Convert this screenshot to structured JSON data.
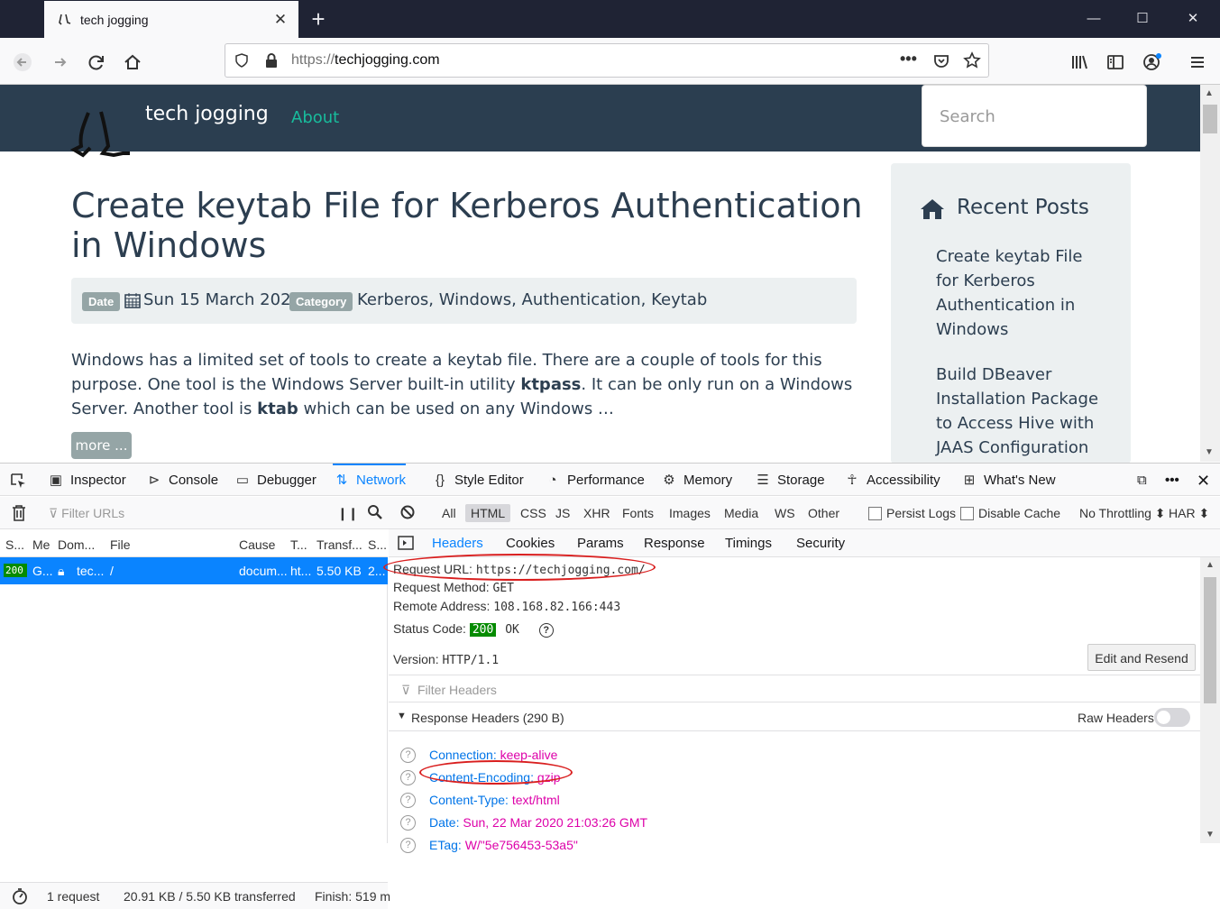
{
  "browser": {
    "tab_title": "tech jogging",
    "url_protocol": "https://",
    "url_host": "techjogging.com"
  },
  "site": {
    "name": "tech jogging",
    "nav_about": "About",
    "search_placeholder": "Search",
    "post_title": "Create keytab File for Kerberos Authentication in Windows",
    "date_badge": "Date",
    "date": "Sun 15 March 2020",
    "category_badge": "Category",
    "categories": "Kerberos, Windows, Authentication, Keytab",
    "excerpt_1": "Windows has a limited set of tools to create a keytab file. There are a couple of tools for this purpose. One tool is the Windows Server built-in utility ",
    "excerpt_bold_1": "ktpass",
    "excerpt_2": ". It can be only run on a Windows Server. Another tool is ",
    "excerpt_bold_2": "ktab",
    "excerpt_3": " which can be used on any Windows …",
    "more_button": "more ...",
    "sidebar_heading": "Recent Posts",
    "recent_posts": [
      "Create keytab File for Kerberos Authentication in Windows",
      "Build DBeaver Installation Package to Access Hive with JAAS Configuration"
    ]
  },
  "devtools": {
    "tabs": [
      "Inspector",
      "Console",
      "Debugger",
      "Network",
      "Style Editor",
      "Performance",
      "Memory",
      "Storage",
      "Accessibility",
      "What's New"
    ],
    "selected_tab": "Network",
    "filter_placeholder": "Filter URLs",
    "type_filters": [
      "All",
      "HTML",
      "CSS",
      "JS",
      "XHR",
      "Fonts",
      "Images",
      "Media",
      "WS",
      "Other"
    ],
    "selected_filter": "HTML",
    "persist_logs": "Persist Logs",
    "disable_cache": "Disable Cache",
    "throttling": "No Throttling",
    "har": "HAR",
    "columns": [
      "S...",
      "Me",
      "Dom...",
      "File",
      "Cause",
      "T...",
      "Transf...",
      "S..."
    ],
    "request": {
      "status": "200",
      "method": "G...",
      "domain": "tec...",
      "file": "/",
      "cause": "docum...",
      "type": "ht...",
      "transferred": "5.50 KB",
      "size": "2..."
    },
    "footer": {
      "requests": "1 request",
      "transferred": "20.91 KB / 5.50 KB transferred",
      "finish": "Finish: 519 m"
    },
    "detail_tabs": [
      "Headers",
      "Cookies",
      "Params",
      "Response",
      "Timings",
      "Security"
    ],
    "selected_detail_tab": "Headers",
    "request_url_label": "Request URL:",
    "request_url": "https://techjogging.com/",
    "request_method_label": "Request Method:",
    "request_method": "GET",
    "remote_address_label": "Remote Address:",
    "remote_address": "108.168.82.166:443",
    "status_code_label": "Status Code:",
    "status_code": "200",
    "status_text": "OK",
    "version_label": "Version:",
    "version": "HTTP/1.1",
    "edit_resend": "Edit and Resend",
    "filter_headers": "Filter Headers",
    "response_headers_title": "Response Headers (290 B)",
    "raw_headers": "Raw Headers",
    "response_headers": [
      {
        "name": "Connection:",
        "value": "keep-alive"
      },
      {
        "name": "Content-Encoding:",
        "value": "gzip"
      },
      {
        "name": "Content-Type:",
        "value": "text/html"
      },
      {
        "name": "Date:",
        "value": "Sun, 22 Mar 2020 21:03:26 GMT"
      },
      {
        "name": "ETag:",
        "value": "W/\"5e756453-53a5\""
      }
    ]
  },
  "colors": {
    "site_header": "#2b3e50",
    "accent": "#18bc9c",
    "devtools_selected": "#0a84ff",
    "annotation": "#d91f1f"
  }
}
